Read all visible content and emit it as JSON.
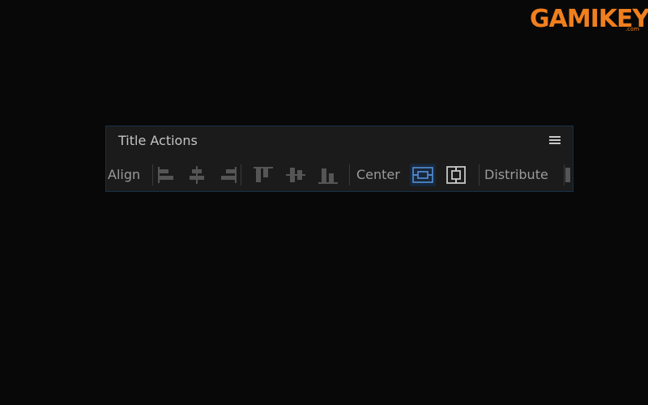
{
  "watermark": {
    "text": "GAMIKEY",
    "sub": ".com",
    "color": "#f07f1e"
  },
  "panel": {
    "title": "Title Actions",
    "menu_icon": "hamburger-menu-icon",
    "border_color": "#16304a",
    "background": "#1b1b1b"
  },
  "toolbar": {
    "align_label": "Align",
    "center_label": "Center",
    "distribute_label": "Distribute",
    "align_buttons": [
      {
        "icon": "align-left-icon"
      },
      {
        "icon": "align-horizontal-center-icon"
      },
      {
        "icon": "align-right-icon"
      },
      {
        "icon": "align-top-icon"
      },
      {
        "icon": "align-vertical-center-icon"
      },
      {
        "icon": "align-bottom-icon"
      }
    ],
    "center_buttons": [
      {
        "icon": "center-horizontal-icon",
        "active": true
      },
      {
        "icon": "center-vertical-icon",
        "active": false
      }
    ],
    "active_color": "#4d86c8"
  }
}
